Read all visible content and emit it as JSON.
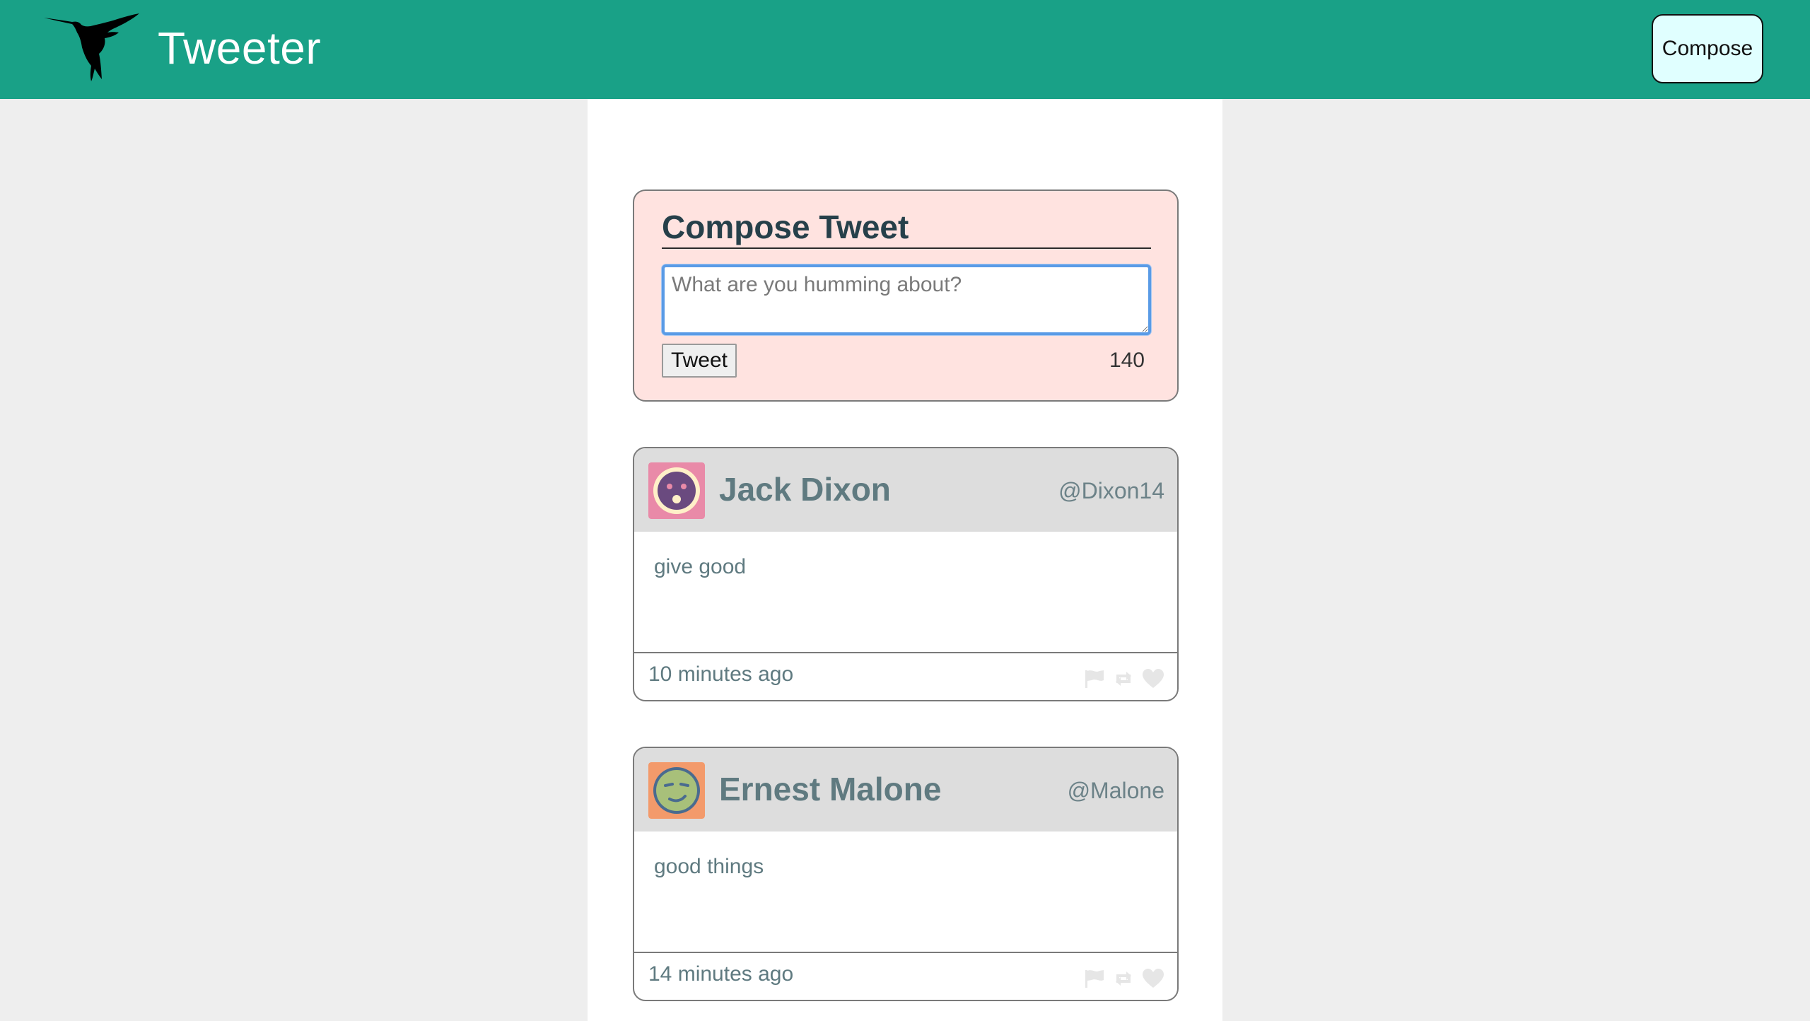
{
  "nav": {
    "brand": "Tweeter",
    "compose_label": "Compose",
    "logo_icon": "hummingbird-icon"
  },
  "compose": {
    "title": "Compose Tweet",
    "placeholder": "What are you humming about?",
    "value": "",
    "submit_label": "Tweet",
    "counter": "140"
  },
  "tweets": [
    {
      "name": "Jack Dixon",
      "handle": "@Dixon14",
      "content": "give good",
      "time": "10 minutes ago",
      "avatar_icon": "surprised-face-icon",
      "avatar_bg": "#e98aa8",
      "avatar_face": "#6a4a7f",
      "avatar_ring": "#fff0c8"
    },
    {
      "name": "Ernest Malone",
      "handle": "@Malone",
      "content": "good things",
      "time": "14 minutes ago",
      "avatar_icon": "smirk-face-icon",
      "avatar_bg": "#f39a6b",
      "avatar_face": "#a8c07a",
      "avatar_ring": "#4a6b8f"
    }
  ],
  "colors": {
    "navbar": "#19a187",
    "page_bg": "#eeeeee",
    "compose_bg": "#ffe3e0",
    "compose_button_bg": "#e0ffff",
    "tweet_header_bg": "#dddddd",
    "text_muted": "#5f7a80"
  }
}
